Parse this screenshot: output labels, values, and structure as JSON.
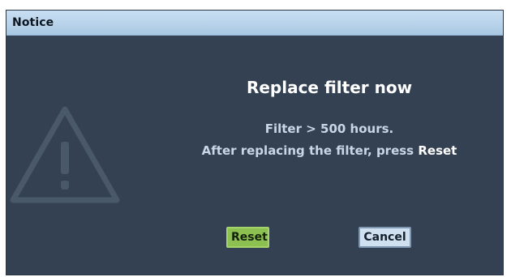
{
  "window": {
    "title": "Notice"
  },
  "icon": "warning-triangle-icon",
  "dialog": {
    "heading": "Replace filter now",
    "line1": "Filter > 500 hours.",
    "line2_prefix": "After replacing the filter, press ",
    "line2_emphasis": "Reset"
  },
  "buttons": {
    "reset_label": "Reset",
    "cancel_label": "Cancel"
  },
  "colors": {
    "background": "#334152",
    "titlebar": "#b7d2ea",
    "reset_button": "#8cc152",
    "cancel_button": "#cfe0f1"
  }
}
